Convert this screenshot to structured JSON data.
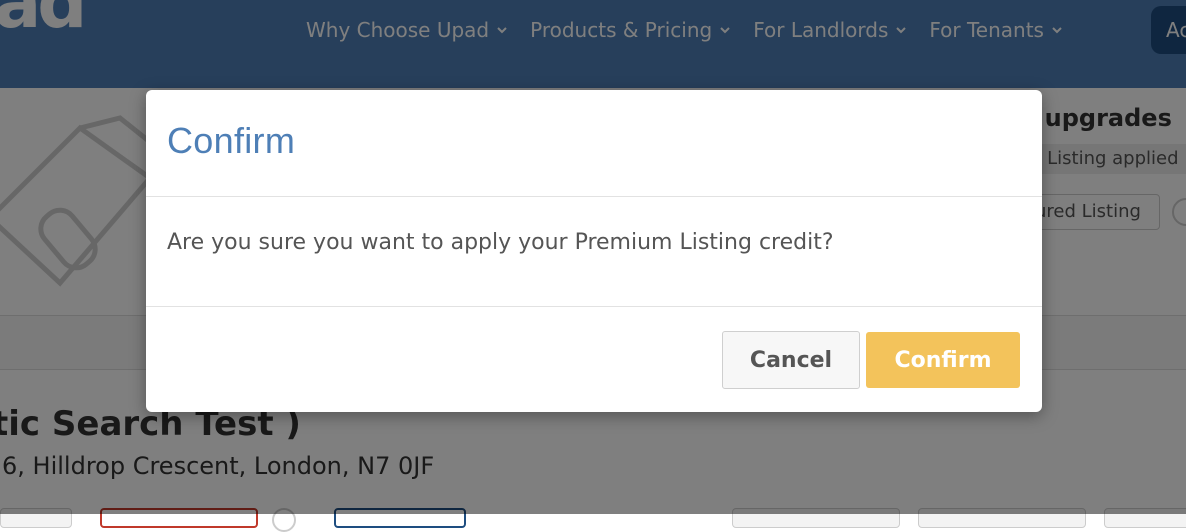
{
  "header": {
    "logo_text": "ad",
    "nav": [
      {
        "label": "Why Choose Upad"
      },
      {
        "label": "Products & Pricing"
      },
      {
        "label": "For Landlords"
      },
      {
        "label": "For Tenants"
      }
    ],
    "account_label": "Ac"
  },
  "background": {
    "upgrades_title": "e upgrades",
    "upgrade_status": "n Listing applied",
    "featured_button": "ured Listing",
    "property_title": "tic Search Test )",
    "property_address": "6, Hilldrop Crescent, London, N7 0JF"
  },
  "modal": {
    "title": "Confirm",
    "message": "Are you sure you want to apply your Premium Listing credit?",
    "cancel_label": "Cancel",
    "confirm_label": "Confirm"
  },
  "colors": {
    "brand_blue": "#4e7fb6",
    "confirm_yellow": "#f3c35b",
    "backdrop": "rgba(0,0,0,0.5)"
  }
}
